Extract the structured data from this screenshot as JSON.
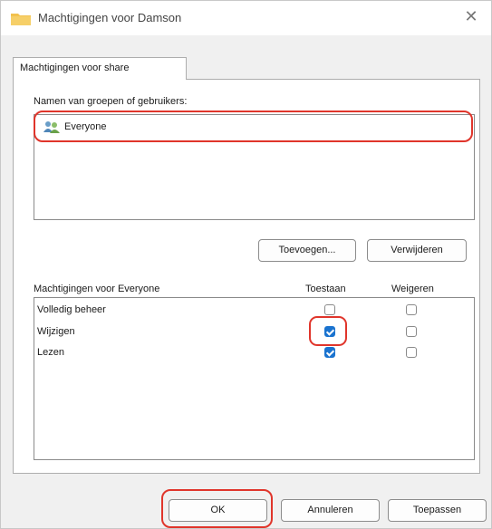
{
  "window": {
    "title": "Machtigingen voor Damson",
    "close_icon": "close-icon"
  },
  "tabs": [
    {
      "label": "Machtigingen voor share",
      "selected": true
    }
  ],
  "groups": {
    "label": "Namen van groepen of gebruikers:",
    "items": [
      {
        "name": "Everyone",
        "icon": "users-icon",
        "selected": true
      }
    ],
    "add_label": "Toevoegen...",
    "remove_label": "Verwijderen"
  },
  "permissions": {
    "header": "Machtigingen voor Everyone",
    "allow_header": "Toestaan",
    "deny_header": "Weigeren",
    "rows": [
      {
        "label": "Volledig beheer",
        "allow": false,
        "deny": false
      },
      {
        "label": "Wijzigen",
        "allow": true,
        "deny": false
      },
      {
        "label": "Lezen",
        "allow": true,
        "deny": false
      }
    ]
  },
  "footer": {
    "ok_label": "OK",
    "cancel_label": "Annuleren",
    "apply_label": "Toepassen"
  },
  "colors": {
    "highlight": "#e0352b",
    "checkbox_checked": "#1a73cf",
    "folder": "#f2c14e"
  }
}
